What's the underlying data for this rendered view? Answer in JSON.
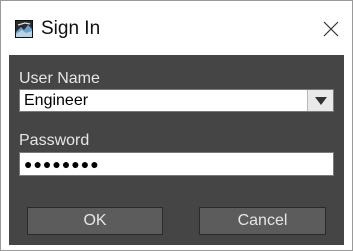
{
  "window": {
    "title": "Sign In",
    "icon": "app-logo-icon",
    "close_icon": "close-icon"
  },
  "form": {
    "user_name_label": "User Name",
    "user_name_value": "Engineer",
    "dropdown_icon": "chevron-down-icon",
    "password_label": "Password",
    "password_value": "●●●●●●●●"
  },
  "buttons": {
    "ok_label": "OK",
    "cancel_label": "Cancel"
  },
  "colors": {
    "body_background": "#454545",
    "button_background": "#5c5c5c",
    "label_text": "#e6e6e6"
  }
}
